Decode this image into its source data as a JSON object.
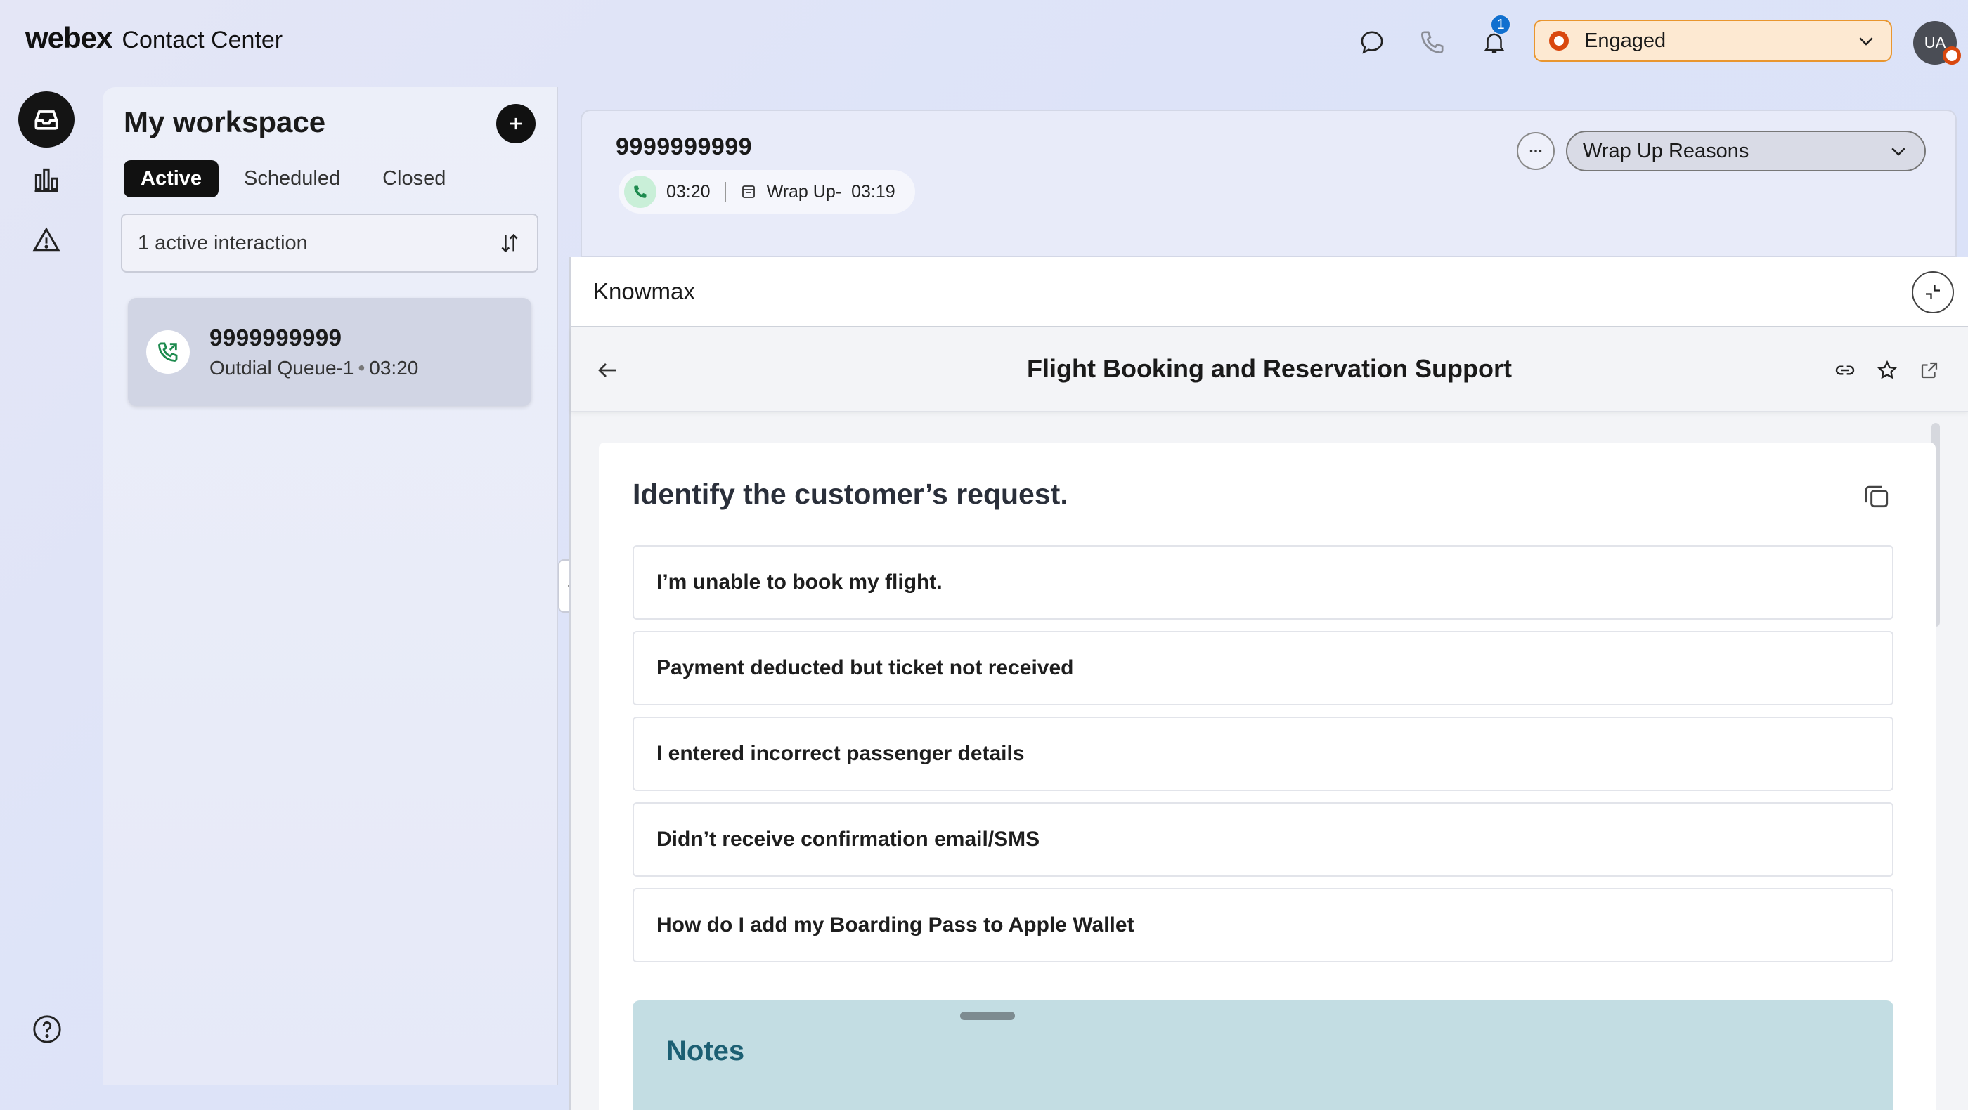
{
  "brand": {
    "logo": "webex",
    "product": "Contact Center"
  },
  "topbar": {
    "icons": [
      "chat-icon",
      "phone-icon",
      "bell-icon"
    ],
    "notification_count": "1",
    "agent_state": "Engaged",
    "avatar_initials": "UA",
    "colors": {
      "engaged_bg": "#fde9d2",
      "engaged_border": "#e9962f",
      "status_dot": "#d9480f",
      "badge": "#1170cf"
    }
  },
  "leftnav": {
    "items": [
      "inbox-icon",
      "analytics-icon",
      "alert-icon"
    ],
    "help": "help-icon"
  },
  "workspace": {
    "title": "My workspace",
    "tabs": [
      {
        "label": "Active",
        "selected": true
      },
      {
        "label": "Scheduled",
        "selected": false
      },
      {
        "label": "Closed",
        "selected": false
      }
    ],
    "filter_label": "1 active interaction",
    "tasks": [
      {
        "number": "9999999999",
        "queue": "Outdial Queue-1",
        "separator": "•",
        "duration": "03:20"
      }
    ]
  },
  "interaction": {
    "number": "9999999999",
    "call_timer": "03:20",
    "wrapup_label": "Wrap Up-",
    "wrapup_timer": "03:19",
    "wrapup_select": "Wrap Up Reasons"
  },
  "knowmax": {
    "widget_title": "Knowmax",
    "doc_title": "Flight Booking and Reservation Support",
    "step_title": "Identify the customer’s request.",
    "options": [
      "I’m unable to book my flight.",
      "Payment deducted but ticket not received",
      "I entered incorrect passenger details",
      "Didn’t receive confirmation email/SMS",
      "How do I add my Boarding Pass to Apple Wallet"
    ],
    "notes_title": "Notes"
  }
}
